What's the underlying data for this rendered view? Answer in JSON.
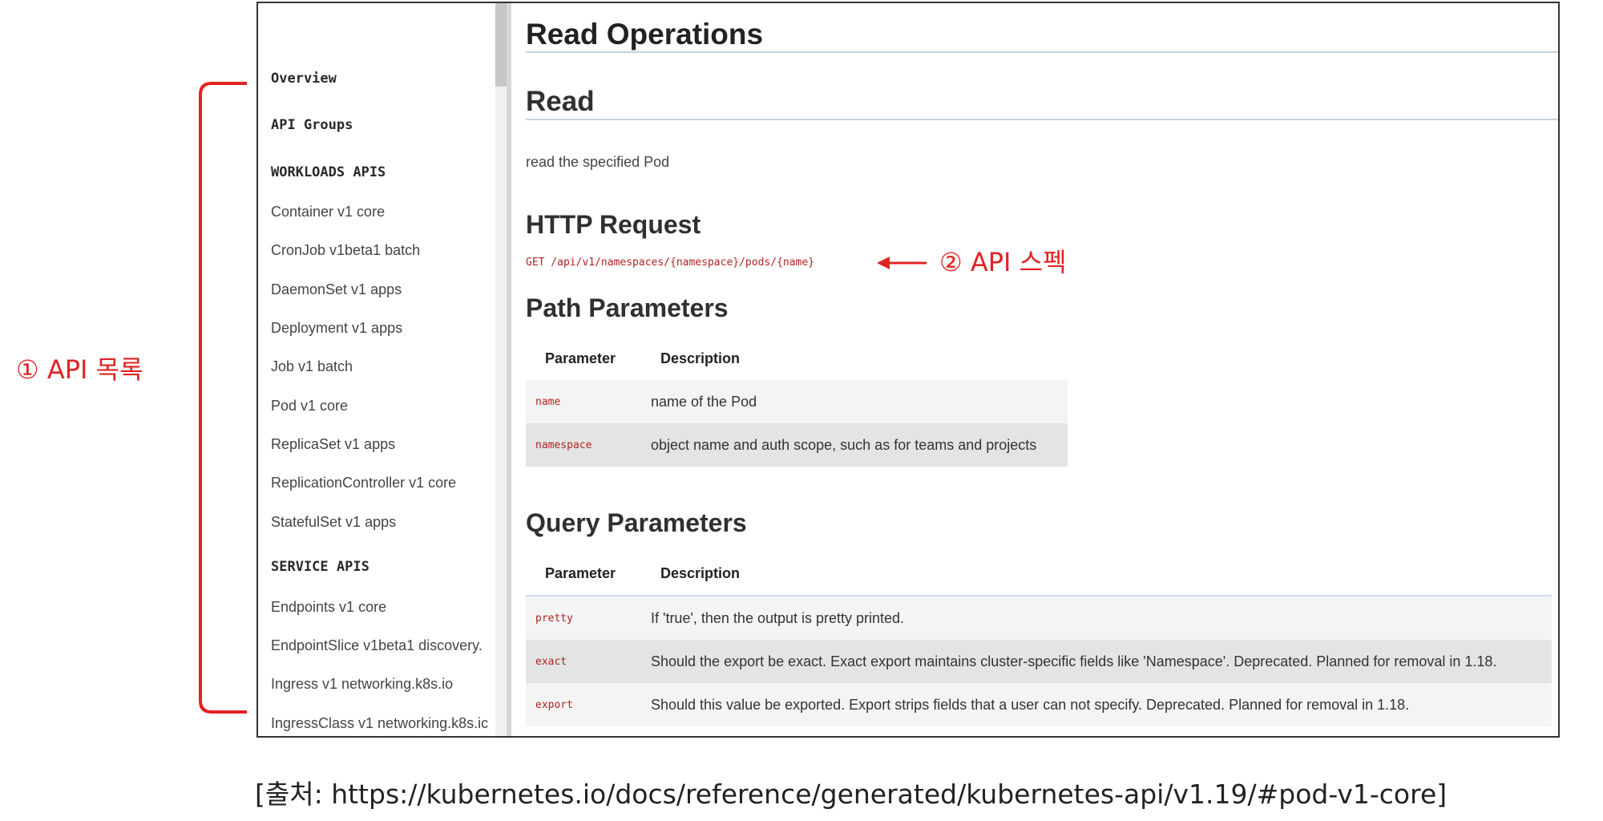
{
  "sidebar": {
    "items": [
      {
        "label": "Overview",
        "style": "mono"
      },
      {
        "label": "API Groups",
        "style": "mono"
      },
      {
        "label": "WORKLOADS APIS",
        "style": "mono"
      },
      {
        "label": "Container v1 core",
        "style": "text"
      },
      {
        "label": "CronJob v1beta1 batch",
        "style": "text"
      },
      {
        "label": "DaemonSet v1 apps",
        "style": "text"
      },
      {
        "label": "Deployment v1 apps",
        "style": "text"
      },
      {
        "label": "Job v1 batch",
        "style": "text"
      },
      {
        "label": "Pod v1 core",
        "style": "text"
      },
      {
        "label": "ReplicaSet v1 apps",
        "style": "text"
      },
      {
        "label": "ReplicationController v1 core",
        "style": "text"
      },
      {
        "label": "StatefulSet v1 apps",
        "style": "text"
      },
      {
        "label": "SERVICE APIS",
        "style": "mono"
      },
      {
        "label": "Endpoints v1 core",
        "style": "text"
      },
      {
        "label": "EndpointSlice v1beta1 discovery.",
        "style": "text"
      },
      {
        "label": "Ingress v1 networking.k8s.io",
        "style": "text"
      },
      {
        "label": "IngressClass v1 networking.k8s.ic",
        "style": "text"
      }
    ]
  },
  "main": {
    "title": "Read Operations",
    "section": "Read",
    "description": "read the specified Pod",
    "http_heading": "HTTP Request",
    "http_request": "GET /api/v1/namespaces/{namespace}/pods/{name}",
    "path_heading": "Path Parameters",
    "path_table": {
      "headers": [
        "Parameter",
        "Description"
      ],
      "rows": [
        {
          "param": "name",
          "desc": "name of the Pod"
        },
        {
          "param": "namespace",
          "desc": "object name and auth scope, such as for teams and projects"
        }
      ]
    },
    "query_heading": "Query Parameters",
    "query_table": {
      "headers": [
        "Parameter",
        "Description"
      ],
      "rows": [
        {
          "param": "pretty",
          "desc": "If 'true', then the output is pretty printed."
        },
        {
          "param": "exact",
          "desc": "Should the export be exact. Exact export maintains cluster-specific fields like 'Namespace'. Deprecated. Planned for removal in 1.18."
        },
        {
          "param": "export",
          "desc": "Should this value be exported. Export strips fields that a user can not specify. Deprecated. Planned for removal in 1.18."
        }
      ]
    }
  },
  "annotations": {
    "api_list": "① API 목록",
    "api_spec": "② API 스펙",
    "color": "#e02424"
  },
  "caption": "[출처: https://kubernetes.io/docs/reference/generated/kubernetes-api/v1.19/#pod-v1-core]"
}
